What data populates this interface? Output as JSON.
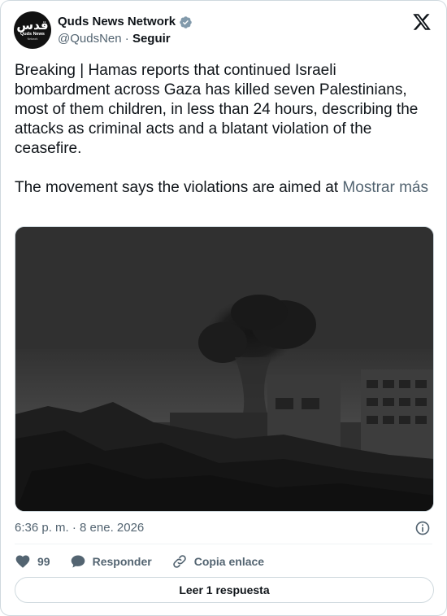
{
  "author": {
    "display_name": "Quds News Network",
    "handle": "@QudsNen",
    "separator": "·",
    "follow_label": "Seguir",
    "avatar_text_arabic": "قدس",
    "avatar_text_english": "Quds News",
    "avatar_text_small": "Network"
  },
  "tweet": {
    "text": "Breaking | Hamas reports that continued Israeli bombardment across Gaza has killed seven Palestinians, most of them children, in less than 24 hours, describing the attacks as criminal acts and a blatant violation of the ceasefire.\n\nThe movement says the violations are aimed at ",
    "show_more_label": "Mostrar más",
    "timestamp": "6:36 p. m. · 8 ene. 2026"
  },
  "actions": {
    "like_count": "99",
    "reply_label": "Responder",
    "copy_link_label": "Copia enlace"
  },
  "read_replies_label": "Leer 1 respuesta",
  "icons": {
    "verified": "verified-badge-icon",
    "brand": "x-logo-icon",
    "info": "info-icon",
    "like": "heart-icon",
    "reply": "speech-bubble-icon",
    "copy": "link-icon"
  },
  "colors": {
    "text_primary": "#0f1419",
    "text_secondary": "#536471",
    "border": "#cfd9de",
    "like_heart": "#536471"
  }
}
